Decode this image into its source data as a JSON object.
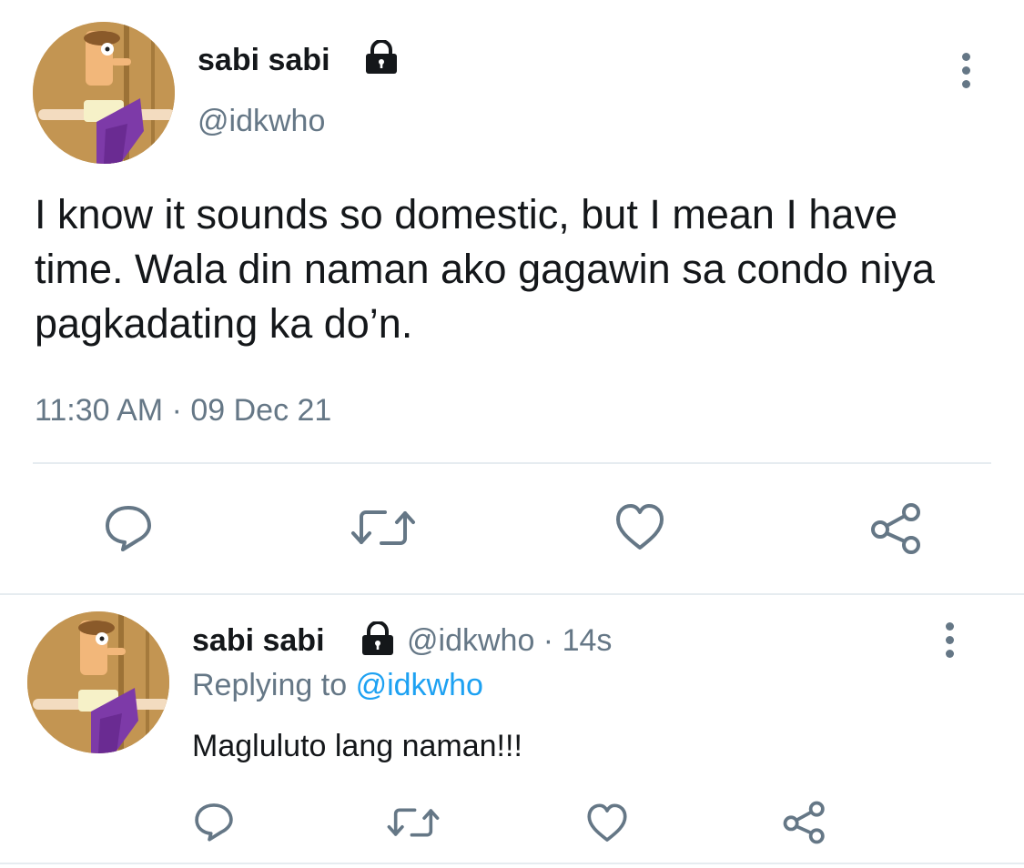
{
  "main_tweet": {
    "display_name": "sabi sabi",
    "handle": "@idkwho",
    "text": "I know it sounds so domestic, but I mean I have time. Wala din naman ako gagawin sa condo niya pagkadating ka do’n.",
    "timestamp": "11:30 AM · 09 Dec 21",
    "icons": [
      "lock-icon",
      "more-icon",
      "reply-icon",
      "retweet-icon",
      "like-icon",
      "share-icon"
    ]
  },
  "reply_tweet": {
    "display_name": "sabi sabi",
    "handle_time": "@idkwho · 14s",
    "replying_prefix": "Replying to",
    "replying_handle": "@idkwho",
    "text": "Magluluto lang naman!!!",
    "icons": [
      "lock-icon",
      "more-icon",
      "reply-icon",
      "retweet-icon",
      "like-icon",
      "share-icon"
    ]
  },
  "colors": {
    "text": "#14171a",
    "muted": "#657786",
    "link": "#1da1f2",
    "divider": "#e6ecf0"
  }
}
